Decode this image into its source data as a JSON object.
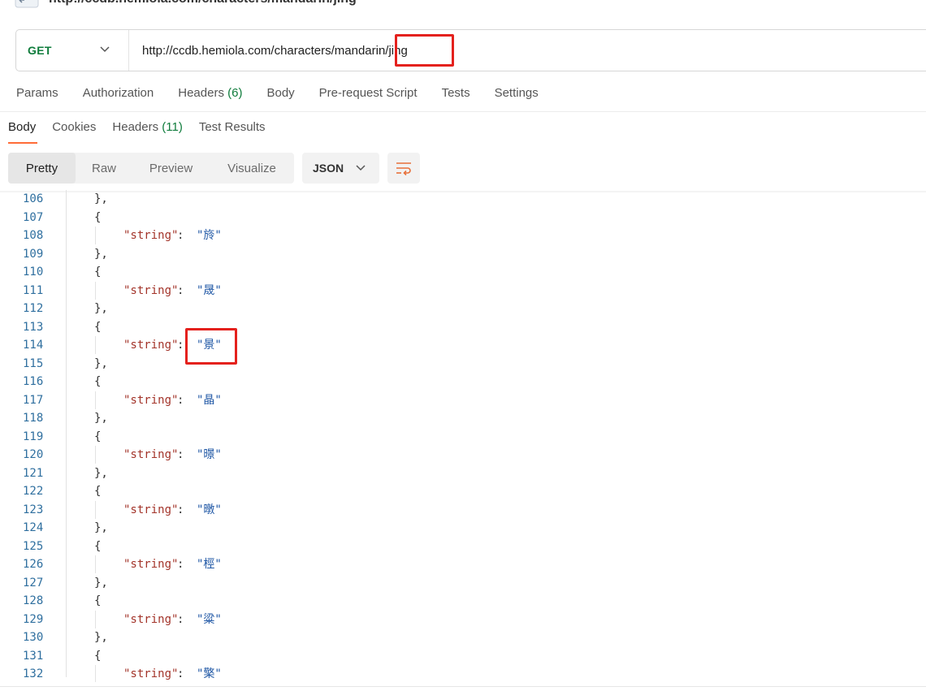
{
  "title": "http://ccdb.hemiola.com/characters/mandarin/jing",
  "request": {
    "method": "GET",
    "url": "http://ccdb.hemiola.com/characters/mandarin/jing"
  },
  "request_tabs": [
    {
      "label": "Params"
    },
    {
      "label": "Authorization"
    },
    {
      "label": "Headers",
      "count": "(6)"
    },
    {
      "label": "Body"
    },
    {
      "label": "Pre-request Script"
    },
    {
      "label": "Tests"
    },
    {
      "label": "Settings"
    }
  ],
  "response_tabs": [
    {
      "label": "Body",
      "active": true
    },
    {
      "label": "Cookies"
    },
    {
      "label": "Headers",
      "count": "(11)"
    },
    {
      "label": "Test Results"
    }
  ],
  "view_modes": [
    "Pretty",
    "Raw",
    "Preview",
    "Visualize"
  ],
  "active_view": "Pretty",
  "format": "JSON",
  "icons": {
    "format_chevron": "chevron-down-icon",
    "wrap": "wrap-lines-icon",
    "method_chevron": "chevron-down-icon"
  },
  "colors": {
    "method": "#0f7c3c",
    "highlight": "#e4211d",
    "key": "#a3342a",
    "value": "#1f57a5",
    "line_number": "#2f6f9f",
    "accent": "#ff6c37"
  },
  "code_lines": [
    {
      "n": "106",
      "kind": "close"
    },
    {
      "n": "107",
      "kind": "open"
    },
    {
      "n": "108",
      "kind": "kv",
      "key": "\"string\"",
      "value": "\"旍\""
    },
    {
      "n": "109",
      "kind": "close"
    },
    {
      "n": "110",
      "kind": "open"
    },
    {
      "n": "111",
      "kind": "kv",
      "key": "\"string\"",
      "value": "\"晟\""
    },
    {
      "n": "112",
      "kind": "close"
    },
    {
      "n": "113",
      "kind": "open"
    },
    {
      "n": "114",
      "kind": "kv",
      "key": "\"string\"",
      "value": "\"景\""
    },
    {
      "n": "115",
      "kind": "close"
    },
    {
      "n": "116",
      "kind": "open"
    },
    {
      "n": "117",
      "kind": "kv",
      "key": "\"string\"",
      "value": "\"晶\""
    },
    {
      "n": "118",
      "kind": "close"
    },
    {
      "n": "119",
      "kind": "open"
    },
    {
      "n": "120",
      "kind": "kv",
      "key": "\"string\"",
      "value": "\"暻\""
    },
    {
      "n": "121",
      "kind": "close"
    },
    {
      "n": "122",
      "kind": "open"
    },
    {
      "n": "123",
      "kind": "kv",
      "key": "\"string\"",
      "value": "\"暾\""
    },
    {
      "n": "124",
      "kind": "close"
    },
    {
      "n": "125",
      "kind": "open"
    },
    {
      "n": "126",
      "kind": "kv",
      "key": "\"string\"",
      "value": "\"桱\""
    },
    {
      "n": "127",
      "kind": "close"
    },
    {
      "n": "128",
      "kind": "open"
    },
    {
      "n": "129",
      "kind": "kv",
      "key": "\"string\"",
      "value": "\"粱\""
    },
    {
      "n": "130",
      "kind": "close"
    },
    {
      "n": "131",
      "kind": "open"
    },
    {
      "n": "132",
      "kind": "kv",
      "key": "\"string\"",
      "value": "\"檠\""
    }
  ]
}
